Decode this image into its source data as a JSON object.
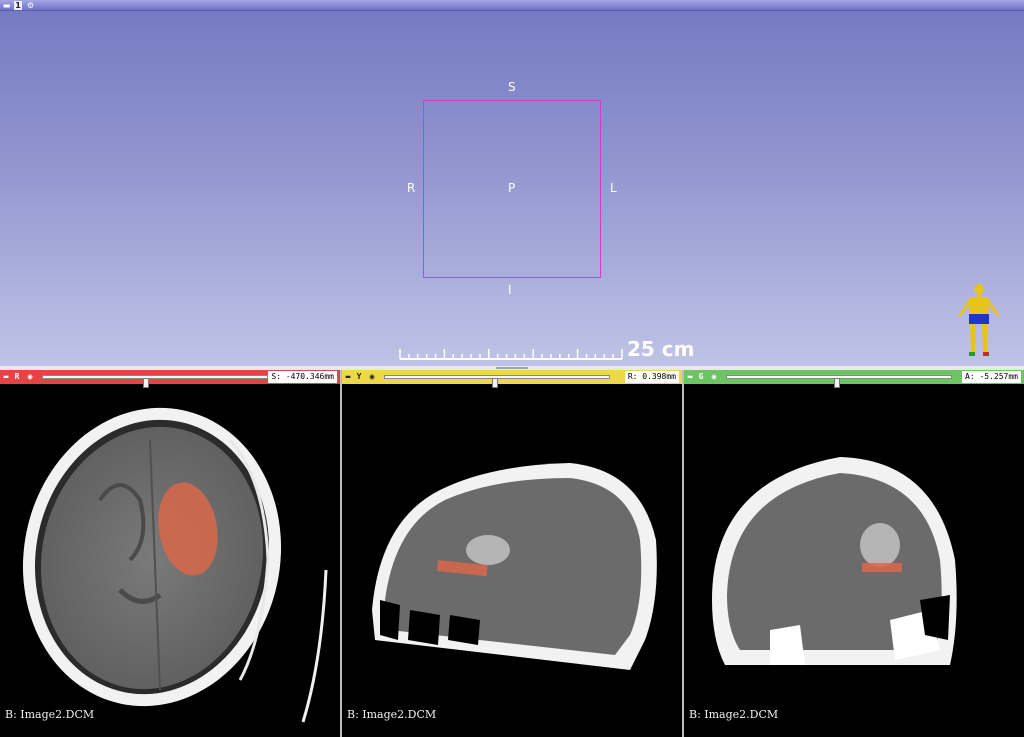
{
  "view3d": {
    "toolbar": {
      "pin_icon": "pin-icon",
      "view_number": "1",
      "gear_icon": "gear-icon"
    },
    "orientation": {
      "superior": "S",
      "inferior": "I",
      "right": "R",
      "left": "L",
      "posterior": "P"
    },
    "ruler_label": "25 cm",
    "colors": {
      "box": "#d23cd0",
      "gradient_top": "#7478c0",
      "gradient_bottom": "#c0c3e6"
    }
  },
  "slice_views": [
    {
      "id": "red",
      "key": "R",
      "offset_value": "S: -470.346mm",
      "slider_fraction": 0.47,
      "background_label": "B: Image2.DCM",
      "color": "#e54444"
    },
    {
      "id": "yellow",
      "key": "Y",
      "offset_value": "R: 0.398mm",
      "slider_fraction": 0.5,
      "background_label": "B: Image2.DCM",
      "color": "#ecd84a"
    },
    {
      "id": "green",
      "key": "G",
      "offset_value": "A: -5.257mm",
      "slider_fraction": 0.5,
      "background_label": "B: Image2.DCM",
      "color": "#6cc462"
    }
  ],
  "segment_color": "#d9674a"
}
